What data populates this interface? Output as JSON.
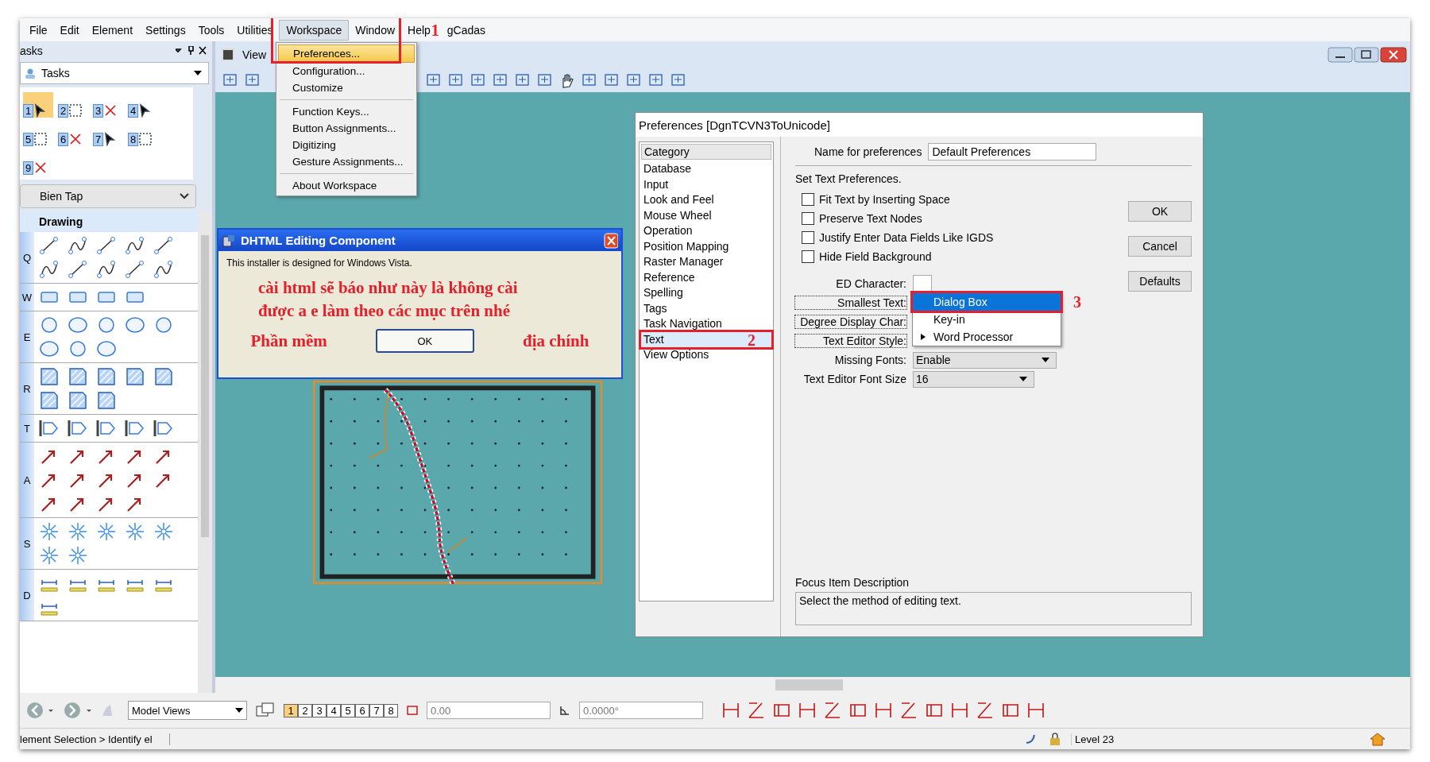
{
  "menu_bar": {
    "items": [
      {
        "label": "File",
        "selected": false
      },
      {
        "label": "Edit",
        "selected": false
      },
      {
        "label": "Element",
        "selected": false
      },
      {
        "label": "Settings",
        "selected": false
      },
      {
        "label": "Tools",
        "selected": false
      },
      {
        "label": "Utilities",
        "selected": false
      },
      {
        "label": "Workspace",
        "selected": true
      },
      {
        "label": "Window",
        "selected": false
      },
      {
        "label": "Help",
        "selected": false
      },
      {
        "label": "gCadas",
        "selected": false
      }
    ]
  },
  "annotations": [
    {
      "label": "1"
    },
    {
      "label": "2"
    },
    {
      "label": "3"
    }
  ],
  "workspace_menu": {
    "groups": [
      [
        {
          "label": "Preferences...",
          "selected": true
        },
        {
          "label": "Configuration...",
          "selected": false
        },
        {
          "label": "Customize",
          "selected": false
        }
      ],
      [
        {
          "label": "Function Keys...",
          "selected": false
        },
        {
          "label": "Button Assignments...",
          "selected": false
        },
        {
          "label": "Digitizing",
          "selected": false
        },
        {
          "label": "Gesture Assignments...",
          "selected": false
        }
      ],
      [
        {
          "label": "About Workspace",
          "selected": false
        }
      ]
    ]
  },
  "tasks_panel": {
    "title": "asks",
    "dropdown": "Tasks",
    "task_numbers": [
      "1",
      "2",
      "3",
      "4",
      "5",
      "6",
      "7",
      "8",
      "9"
    ],
    "tool_group": "Bien Tap",
    "drawing_title": "Drawing",
    "sections": [
      {
        "letter": "Q"
      },
      {
        "letter": "W"
      },
      {
        "letter": "E"
      },
      {
        "letter": "R"
      },
      {
        "letter": "T"
      },
      {
        "letter": "A"
      },
      {
        "letter": "S"
      },
      {
        "letter": "D"
      }
    ]
  },
  "view_window": {
    "title": "View"
  },
  "dhtml_dialog": {
    "title": "DHTML Editing Component",
    "message": "This installer is designed for Windows Vista.",
    "note_lines": [
      "cài html sẽ báo như này là không cài",
      "được a e làm theo các mục trên nhé"
    ],
    "note_left": "Phần mềm",
    "note_right": "địa chính",
    "button": "OK"
  },
  "preferences": {
    "title": "Preferences [DgnTCVN3ToUnicode]",
    "category_header": "Category",
    "categories": [
      {
        "label": "Database",
        "selected": false
      },
      {
        "label": "Input",
        "selected": false
      },
      {
        "label": "Look and Feel",
        "selected": false
      },
      {
        "label": "Mouse Wheel",
        "selected": false
      },
      {
        "label": "Operation",
        "selected": false
      },
      {
        "label": "Position Mapping",
        "selected": false
      },
      {
        "label": "Raster Manager",
        "selected": false
      },
      {
        "label": "Reference",
        "selected": false
      },
      {
        "label": "Spelling",
        "selected": false
      },
      {
        "label": "Tags",
        "selected": false
      },
      {
        "label": "Task Navigation",
        "selected": false
      },
      {
        "label": "Text",
        "selected": true
      },
      {
        "label": "View Options",
        "selected": false
      }
    ],
    "name_label": "Name for preferences",
    "name_value": "Default Preferences",
    "section_title": "Set Text Preferences.",
    "checkboxes": [
      {
        "label": "Fit Text by Inserting Space",
        "checked": false
      },
      {
        "label": "Preserve Text Nodes",
        "checked": false
      },
      {
        "label": "Justify Enter Data Fields Like IGDS",
        "checked": false
      },
      {
        "label": "Hide Field Background",
        "checked": false
      }
    ],
    "buttons": [
      "OK",
      "Cancel",
      "Defaults"
    ],
    "fields": [
      {
        "label": "ED Character:",
        "kind": "char"
      },
      {
        "label": "Smallest Text:",
        "kind": "hidden"
      },
      {
        "label": "Degree Display Char:",
        "kind": "hidden"
      },
      {
        "label": "Text Editor Style:",
        "kind": "hidden"
      },
      {
        "label": "Missing Fonts:",
        "kind": "dropdown",
        "value": "Enable"
      },
      {
        "label": "Text Editor Font Size",
        "kind": "dropdown",
        "value": "16"
      }
    ],
    "popup": [
      {
        "label": "Dialog Box",
        "selected": true,
        "current": false
      },
      {
        "label": "Key-in",
        "selected": false,
        "current": false
      },
      {
        "label": "Word Processor",
        "selected": false,
        "current": true
      }
    ],
    "focus_label": "Focus Item Description",
    "focus_text": "Select the method of editing text."
  },
  "bottom_toolbar": {
    "view_set": "Model Views",
    "view_numbers": [
      {
        "label": "1",
        "selected": true
      },
      {
        "label": "2",
        "selected": false
      },
      {
        "label": "3",
        "selected": false
      },
      {
        "label": "4",
        "selected": false
      },
      {
        "label": "5",
        "selected": false
      },
      {
        "label": "6",
        "selected": false
      },
      {
        "label": "7",
        "selected": false
      },
      {
        "label": "8",
        "selected": false
      }
    ],
    "distance": "0.00",
    "angle": "0.0000°"
  },
  "status_bar": {
    "message": "lement Selection > Identify el",
    "active_level": "Level 23"
  }
}
